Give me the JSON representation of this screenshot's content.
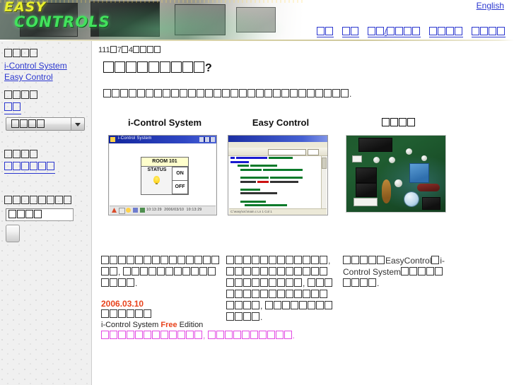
{
  "header": {
    "logo_line1": "EASY",
    "logo_line2": "CONTROLS",
    "english_link": "English"
  },
  "nav": {
    "items": [
      {
        "name": "nav-item-1",
        "tofu": 2
      },
      {
        "name": "nav-item-2",
        "tofu": 2
      },
      {
        "name": "nav-item-3",
        "tofu": 2,
        "sep": "/",
        "tofu2": 4
      },
      {
        "name": "nav-item-4",
        "tofu": 4
      },
      {
        "name": "nav-item-5",
        "tofu": 4
      }
    ]
  },
  "sidebar": {
    "section1_heading_tofu": 4,
    "section1_links": [
      "i-Control System",
      "Easy Control"
    ],
    "section2_heading_tofu": 4,
    "section2_link_tofu": 2,
    "select_value_tofu": 4,
    "section3_heading_tofu": 4,
    "section3_link_tofu": 6,
    "search_label_tofu": 8,
    "search_input_value_tofu": 4
  },
  "main": {
    "date_prefix": "111",
    "date_mid": "7",
    "date_num": "4",
    "date_suffix_tofu": 4,
    "title_tofu": 9,
    "title_suffix": "?",
    "intro_tofu": 29,
    "intro_suffix": ".",
    "columns": [
      {
        "id": "col-i-control-system",
        "title": "i-Control System",
        "shot": "app-window-screenshot",
        "shot_titlebar": "i-Control System",
        "shot_room": "ROOM 101",
        "shot_status": "STATUS",
        "shot_on": "ON",
        "shot_off": "OFF",
        "body_tofu_line1": 16,
        "body_punct1": ", ",
        "body_tofu_line1b": 2,
        "body_tofu_line2": 13,
        "body_suffix": "."
      },
      {
        "id": "col-easy-control",
        "title": "Easy Control",
        "shot": "code-editor-screenshot",
        "body_tofu_line1": 12,
        "body_tofu_line2": 10,
        "body_tofu_line3": 11,
        "body_tofu_line4": 10,
        "body_tofu_line5": 9,
        "body_tofu_line6": 12,
        "body_suffix": "."
      },
      {
        "id": "col-hardware",
        "title_tofu": 4,
        "shot": "pcb-photo",
        "body_tofu_pre": 5,
        "body_text1": "EasyControl",
        "body_tofu_mid": 1,
        "body_text2": "i-Control System",
        "body_tofu_post": 9,
        "body_suffix": "."
      }
    ],
    "news": {
      "date": "2006.03.10",
      "headline_tofu": 6,
      "product_prefix": "i-Control System ",
      "product_free": "Free",
      "product_suffix": " Edition"
    },
    "footnote_tofu_1": 12,
    "footnote_punct": ", ",
    "footnote_tofu_2": 10,
    "footnote_suffix": "."
  },
  "colors": {
    "link": "#2b37cf",
    "accent_red": "#e8431c",
    "footnote_pink": "#e24ae2",
    "sidebar_bg": "#f0f0f0",
    "logo_yellow": "#e9ef2e",
    "logo_green": "#42e25c"
  }
}
